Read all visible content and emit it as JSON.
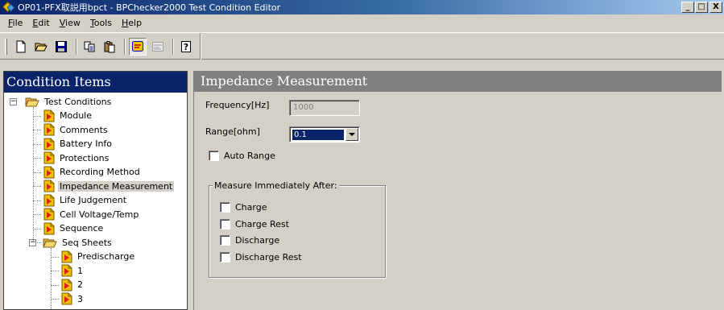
{
  "window": {
    "title": "OP01-PFX取説用bpct - BPChecker2000 Test Condition Editor",
    "controls": {
      "minimize": "_",
      "maximize": "□",
      "close": "X"
    }
  },
  "menu": [
    {
      "prefix": "",
      "accel": "F",
      "rest": "ile"
    },
    {
      "prefix": "",
      "accel": "E",
      "rest": "dit"
    },
    {
      "prefix": "",
      "accel": "V",
      "rest": "iew"
    },
    {
      "prefix": "",
      "accel": "T",
      "rest": "ools"
    },
    {
      "prefix": "",
      "accel": "H",
      "rest": "elp"
    }
  ],
  "toolbar": {
    "icons": [
      "new-file-icon",
      "open-folder-icon",
      "save-disk-icon",
      "copy-icon",
      "paste-icon",
      "condition-items-icon",
      "alt-view-icon",
      "help-icon"
    ],
    "pressed": "condition-items-icon",
    "help_glyph": "?"
  },
  "left_panel": {
    "title": "Condition Items",
    "tree": {
      "root": "Test Conditions",
      "items": [
        "Module",
        "Comments",
        "Battery Info",
        "Protections",
        "Recording Method",
        "Impedance Measurement",
        "Life Judgement",
        "Cell Voltage/Temp",
        "Sequence"
      ],
      "selected": "Impedance Measurement",
      "seq_sheets": {
        "label": "Seq Sheets",
        "children": [
          "Predischarge",
          "1",
          "2",
          "3"
        ]
      }
    }
  },
  "right_panel": {
    "title": "Impedance Measurement",
    "frequency": {
      "label": "Frequency[Hz]",
      "value": "1000"
    },
    "range": {
      "label": "Range[ohm]",
      "value": "0.1"
    },
    "auto_range": {
      "label": "Auto Range",
      "checked": false
    },
    "measure_group": {
      "title": "Measure Immediately After:",
      "options": [
        "Charge",
        "Charge Rest",
        "Discharge",
        "Discharge Rest"
      ]
    }
  },
  "colors": {
    "title_gradient_start": "#0a246a",
    "title_gradient_end": "#a6caf0",
    "left_header_bg": "#0a246a",
    "right_header_bg": "#808080",
    "face": "#d4d0c8"
  }
}
